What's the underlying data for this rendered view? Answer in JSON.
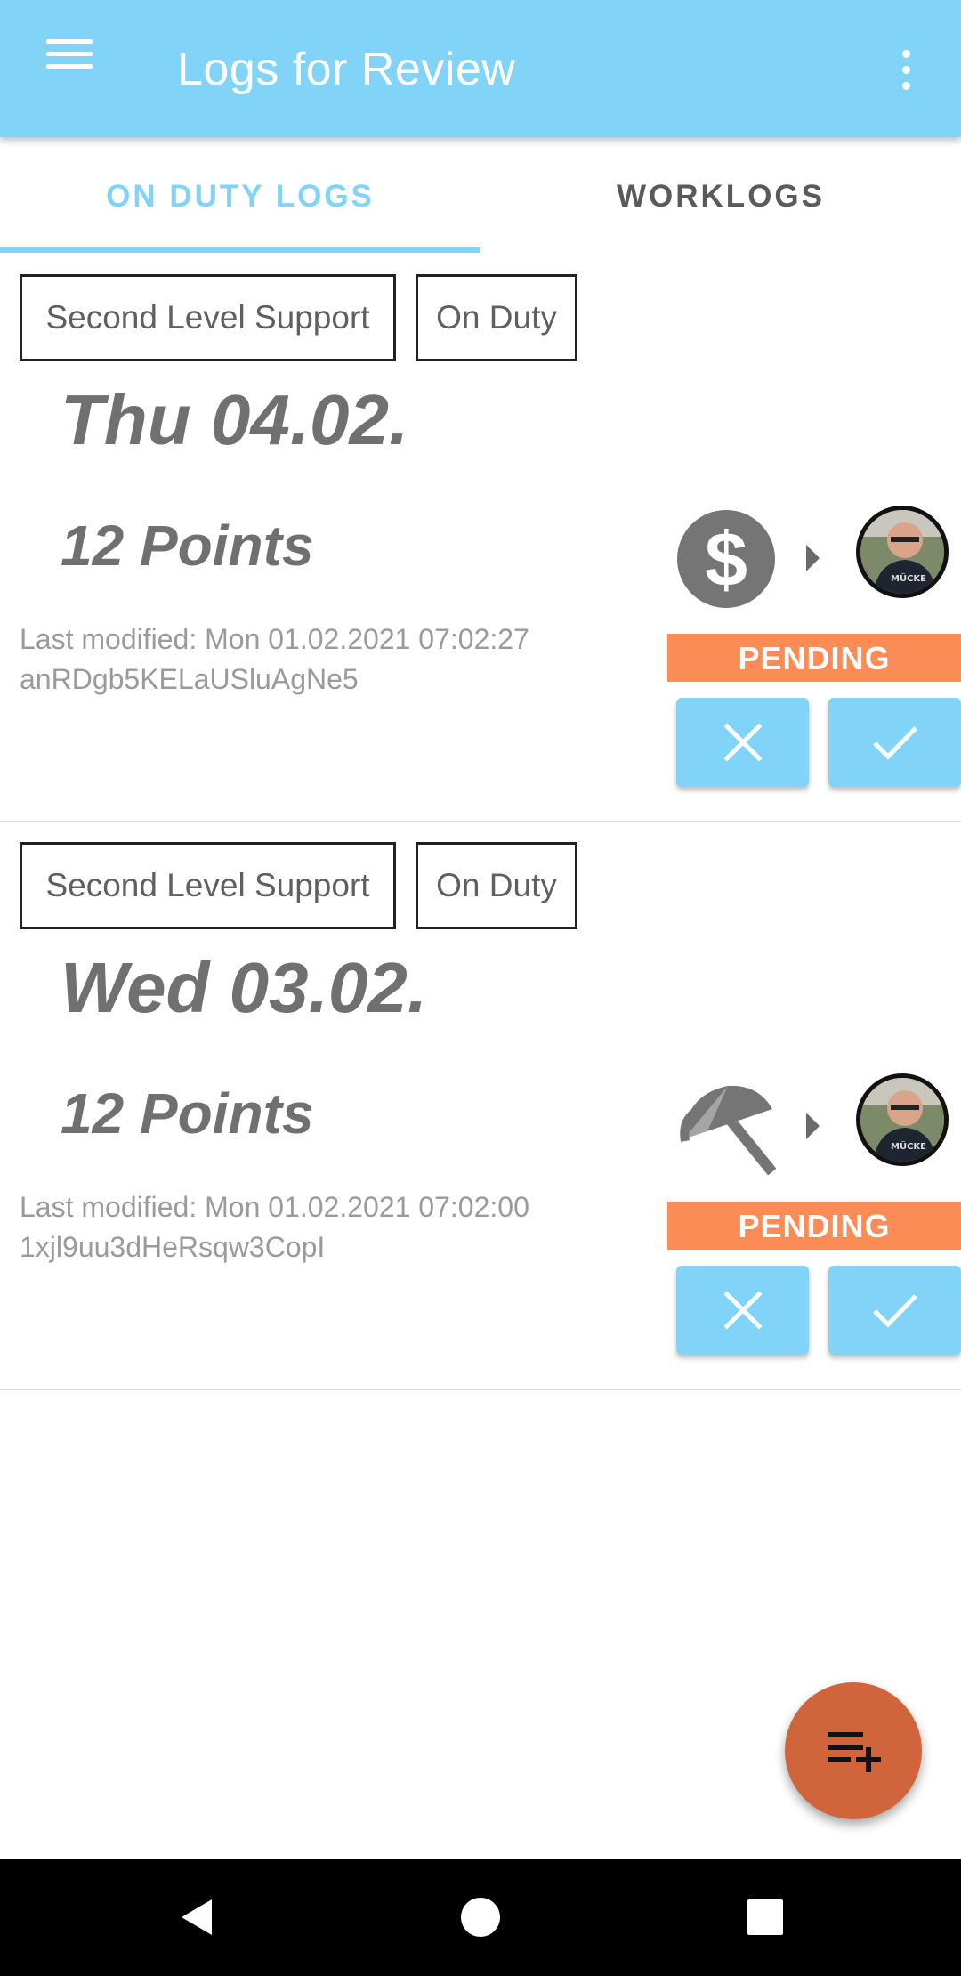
{
  "appbar": {
    "title": "Logs for Review",
    "menu_icon": "hamburger-menu-icon",
    "more_icon": "more-vert-icon"
  },
  "tabs": [
    {
      "label": "ON DUTY LOGS",
      "active": true
    },
    {
      "label": "WORKLOGS",
      "active": false
    }
  ],
  "logs": [
    {
      "team": "Second Level Support",
      "type": "On Duty",
      "date": "Thu 04.02.",
      "points": "12 Points",
      "modified": "Last modified: Mon 01.02.2021 07:02:27",
      "id": "anRDgb5KELaUSluAgNe5",
      "icon": "dollar-icon",
      "status": "PENDING"
    },
    {
      "team": "Second Level Support",
      "type": "On Duty",
      "date": "Wed 03.02.",
      "points": "12 Points",
      "modified": "Last modified: Mon 01.02.2021 07:02:00",
      "id": "1xjl9uu3dHeRsqw3CopI",
      "icon": "umbrella-icon",
      "status": "PENDING"
    }
  ],
  "colors": {
    "primary": "#81d4f7",
    "pending": "#fc8c56",
    "fab": "#d0643a"
  },
  "fab": {
    "icon": "playlist-add-icon"
  }
}
